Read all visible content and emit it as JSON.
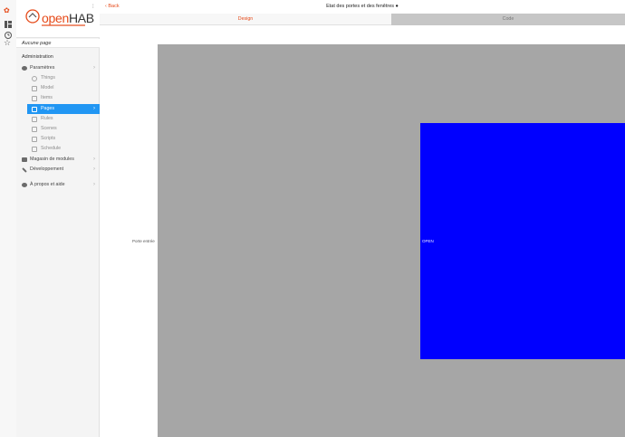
{
  "rail": {
    "icons": [
      "openhab-logo-icon",
      "pages-icon",
      "history-icon",
      "star-icon"
    ]
  },
  "logo": {
    "part1": "open",
    "part2": "HAB"
  },
  "sidebar": {
    "current_page": "Aucune page",
    "section": "Administration",
    "items": [
      {
        "label": "Paramètres",
        "icon": "gear-icon"
      },
      {
        "label": "Magasin de modules",
        "icon": "store-icon"
      },
      {
        "label": "Développement",
        "icon": "wrench-icon"
      },
      {
        "label": "À propos et aide",
        "icon": "help-icon"
      }
    ],
    "settings_items": [
      {
        "label": "Things",
        "icon": "lightbulb-icon"
      },
      {
        "label": "Model",
        "icon": "list-icon"
      },
      {
        "label": "Items",
        "icon": "copy-icon"
      },
      {
        "label": "Pages",
        "icon": "tv-icon",
        "active": true
      },
      {
        "label": "Rules",
        "icon": "wand-icon"
      },
      {
        "label": "Scenes",
        "icon": "film-icon"
      },
      {
        "label": "Scripts",
        "icon": "doc-icon"
      },
      {
        "label": "Schedule",
        "icon": "calendar-icon"
      }
    ]
  },
  "header": {
    "back_label": "Back",
    "title": "Etat des portes et des fenêtres ●"
  },
  "tabs": [
    {
      "label": "Design"
    },
    {
      "label": "Code"
    }
  ],
  "canvas": {
    "label_left": "Porte entrée",
    "label_state": "OPEN",
    "colors": {
      "background": "#a6a6a6",
      "state_box": "#0000ff"
    }
  }
}
